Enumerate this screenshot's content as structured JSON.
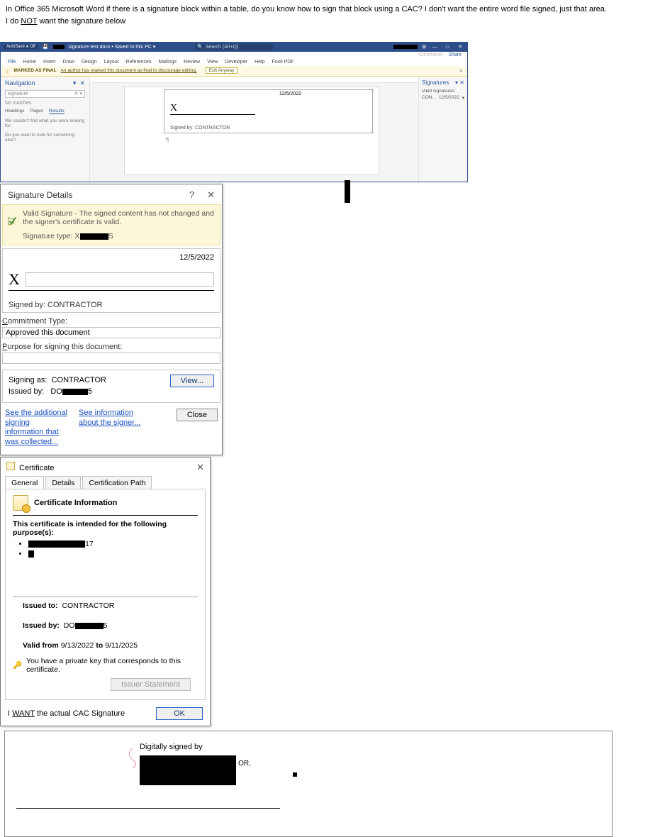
{
  "post": {
    "line1_a": "In Office 365 Microsoft Word if there is a signature block within a table, do you know how to sign that block using a CAC? I don't want the entire word file signed, just that area.",
    "line2_a": "I do ",
    "line2_u": "NOT",
    "line2_b": " want the signature below"
  },
  "word": {
    "autosave": "AutoSave ● Off",
    "titlebar_redact_w": 16,
    "doc_title": "signature test.docx • Saved to this PC  ▾",
    "search_placeholder": "Search (Alt+Q)",
    "right_redact_w": 34,
    "comments": "Comments",
    "share": "Share",
    "tabs": [
      "File",
      "Home",
      "Insert",
      "Draw",
      "Design",
      "Layout",
      "References",
      "Mailings",
      "Review",
      "View",
      "Developer",
      "Help",
      "Foxit PDF"
    ],
    "msgbar_label": "MARKED AS FINAL",
    "msgbar_text": "An author has marked this document as final to discourage editing.",
    "msgbar_btn": "Edit Anyway",
    "nav": {
      "title": "Navigation",
      "search_value": "signature",
      "nomatches": "No matches",
      "tabs": [
        "Headings",
        "Pages",
        "Results"
      ],
      "msg1": "We couldn't find what you were looking for.",
      "msg2": "Do you want to look for something else?"
    },
    "doc": {
      "date": "12/5/2022",
      "x": "X",
      "signed_by": "Signed by: CONTRACTOR",
      "para": "¶"
    },
    "sigpane": {
      "title": "Signatures",
      "valid": "Valid signatures:",
      "entry_name": "CON...",
      "entry_date": "12/5/2022"
    }
  },
  "dlg_sig": {
    "title": "Signature Details",
    "help": "?",
    "close": "✕",
    "valid_text": "Valid Signature - The signed content has not changed and the signer's certificate is valid.",
    "sigtype_label": "Signature type: X",
    "sigtype_trail": "S",
    "date": "12/5/2022",
    "bigx": "X",
    "signed_by": "Signed by: CONTRACTOR",
    "commit_label": "Commitment Type:",
    "commit_value": "Approved this document",
    "purpose_label": "Purpose for signing this document:",
    "signing_as_l": "Signing as:",
    "signing_as_v": "CONTRACTOR",
    "issued_by_l": "Issued by:",
    "issued_by_v1": "DO",
    "issued_by_v2": "5",
    "view_btn": "View...",
    "link1": "See the additional signing information that was collected...",
    "link2": "See information about the signer...",
    "close_btn": "Close"
  },
  "dlg_cert": {
    "title": "Certificate",
    "close": "✕",
    "tabs": [
      "General",
      "Details",
      "Certification Path"
    ],
    "info_h": "Certificate Information",
    "purpose_h": "This certificate is intended for the following purpose(s):",
    "bullet_tail": "17",
    "issued_to_l": "Issued to:",
    "issued_to_v": "CONTRACTOR",
    "issued_by_l": "Issued by:",
    "issued_by_v1": "DO",
    "issued_by_v2": "5",
    "valid_l": "Valid from",
    "valid_from": "9/13/2022",
    "valid_to_l": "to",
    "valid_to": "9/11/2025",
    "keynote": "You have a private key that corresponds to this certificate.",
    "issuer_btn": "Issuer Statement",
    "ok_btn": "OK"
  },
  "want": {
    "text_a": "I ",
    "text_u": "WANT",
    "text_b": " the actual CAC Signature",
    "ds_label": "Digitally signed by",
    "or": "OR,"
  }
}
